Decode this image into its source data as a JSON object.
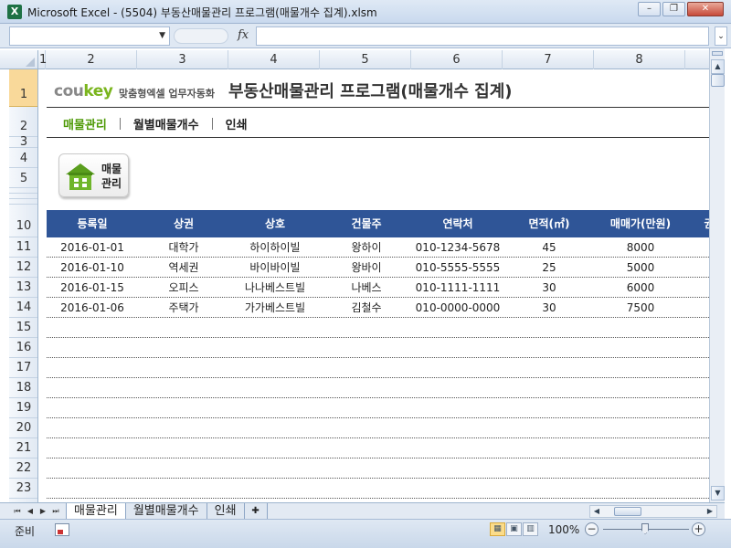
{
  "window": {
    "title": "Microsoft Excel - (5504) 부동산매물관리 프로그램(매물개수 집계).xlsm",
    "app_icon": "X",
    "minimize_icon": "–",
    "restore_icon": "❐",
    "close_icon": "✕"
  },
  "formula_bar": {
    "name_box": "",
    "fx_label": "fx",
    "formula": ""
  },
  "columns": [
    "1",
    "2",
    "3",
    "4",
    "5",
    "6",
    "7",
    "8"
  ],
  "rows": [
    "1",
    "2",
    "3",
    "4",
    "5",
    "10",
    "11",
    "12",
    "13",
    "14",
    "15",
    "16",
    "17",
    "18",
    "19",
    "20",
    "21",
    "22",
    "23"
  ],
  "header": {
    "brand_main": "cou",
    "brand_key": "key",
    "brand_sub": "맞춤형엑셀 업무자동화",
    "title": "부동산매물관리 프로그램(매물개수 집계)"
  },
  "menu": {
    "items": [
      {
        "label": "매물관리"
      },
      {
        "label": "월별매물개수"
      },
      {
        "label": "인쇄"
      }
    ]
  },
  "management_button": {
    "line1": "매물",
    "line2": "관리",
    "icon": "house-icon"
  },
  "table": {
    "headers": [
      "등록일",
      "상권",
      "상호",
      "건물주",
      "연락처",
      "면적(㎡)",
      "매매가(만원)",
      "권"
    ],
    "rows": [
      [
        "2016-01-01",
        "대학가",
        "하이하이빌",
        "왕하이",
        "010-1234-5678",
        "45",
        "8000"
      ],
      [
        "2016-01-10",
        "역세권",
        "바이바이빌",
        "왕바이",
        "010-5555-5555",
        "25",
        "5000"
      ],
      [
        "2016-01-15",
        "오피스",
        "나나베스트빌",
        "나베스",
        "010-1111-1111",
        "30",
        "6000"
      ],
      [
        "2016-01-06",
        "주택가",
        "가가베스트빌",
        "김철수",
        "010-0000-0000",
        "30",
        "7500"
      ]
    ]
  },
  "sheet_tabs": {
    "tabs": [
      "매물관리",
      "월별매물개수",
      "인쇄"
    ],
    "active": "매물관리"
  },
  "status_bar": {
    "status": "준비",
    "zoom": "100%"
  },
  "colors": {
    "accent_green": "#4e9a06",
    "table_header": "#2f5597",
    "brand_key": "#7ab51d",
    "selected_row_header": "#f9d99a"
  }
}
